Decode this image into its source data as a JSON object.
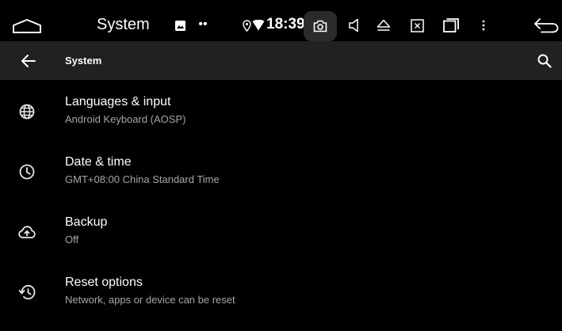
{
  "status_bar": {
    "title": "System",
    "time": "18:39",
    "icons": [
      "home-outline-icon",
      "image-notification-icon",
      "more-dots-icon",
      "location-icon",
      "wifi-icon",
      "camera-icon",
      "volume-icon",
      "eject-icon",
      "close-window-icon",
      "recent-apps-icon",
      "overflow-menu-icon",
      "back-arrow-icon"
    ],
    "dots_text": "••"
  },
  "app_bar": {
    "title": "System",
    "icons": [
      "back-arrow-icon",
      "search-icon"
    ]
  },
  "settings": [
    {
      "title": "Languages & input",
      "subtitle": "Android Keyboard (AOSP)",
      "icon": "globe-icon"
    },
    {
      "title": "Date & time",
      "subtitle": "GMT+08:00 China Standard Time",
      "icon": "clock-icon"
    },
    {
      "title": "Backup",
      "subtitle": "Off",
      "icon": "cloud-upload-icon"
    },
    {
      "title": "Reset options",
      "subtitle": "Network, apps or device can be reset",
      "icon": "restore-icon"
    }
  ],
  "colors": {
    "background": "#000000",
    "app_bar": "#212121",
    "text_primary": "#ffffff",
    "text_secondary": "#a6a6a6",
    "icon": "#e6e6e6"
  }
}
